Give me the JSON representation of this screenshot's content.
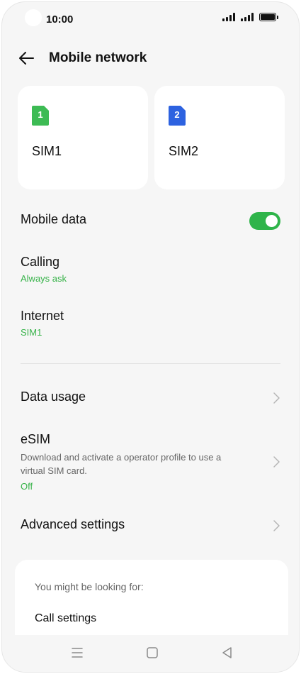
{
  "status_bar": {
    "time": "10:00"
  },
  "header": {
    "title": "Mobile network"
  },
  "sims": [
    {
      "number": "1",
      "label": "SIM1",
      "color": "#3dbb54"
    },
    {
      "number": "2",
      "label": "SIM2",
      "color": "#2d62e0"
    }
  ],
  "settings": {
    "mobile_data": {
      "label": "Mobile data",
      "enabled": true
    },
    "calling": {
      "label": "Calling",
      "value": "Always ask"
    },
    "internet": {
      "label": "Internet",
      "value": "SIM1"
    },
    "data_usage": {
      "label": "Data usage"
    },
    "esim": {
      "label": "eSIM",
      "description": "Download and activate a operator profile to use a virtual SIM card.",
      "value": "Off"
    },
    "advanced": {
      "label": "Advanced settings"
    }
  },
  "suggestions": {
    "header": "You might be looking for:",
    "items": [
      "Call settings"
    ]
  },
  "colors": {
    "accent": "#38b34a",
    "toggle_on": "#2fb44a"
  }
}
